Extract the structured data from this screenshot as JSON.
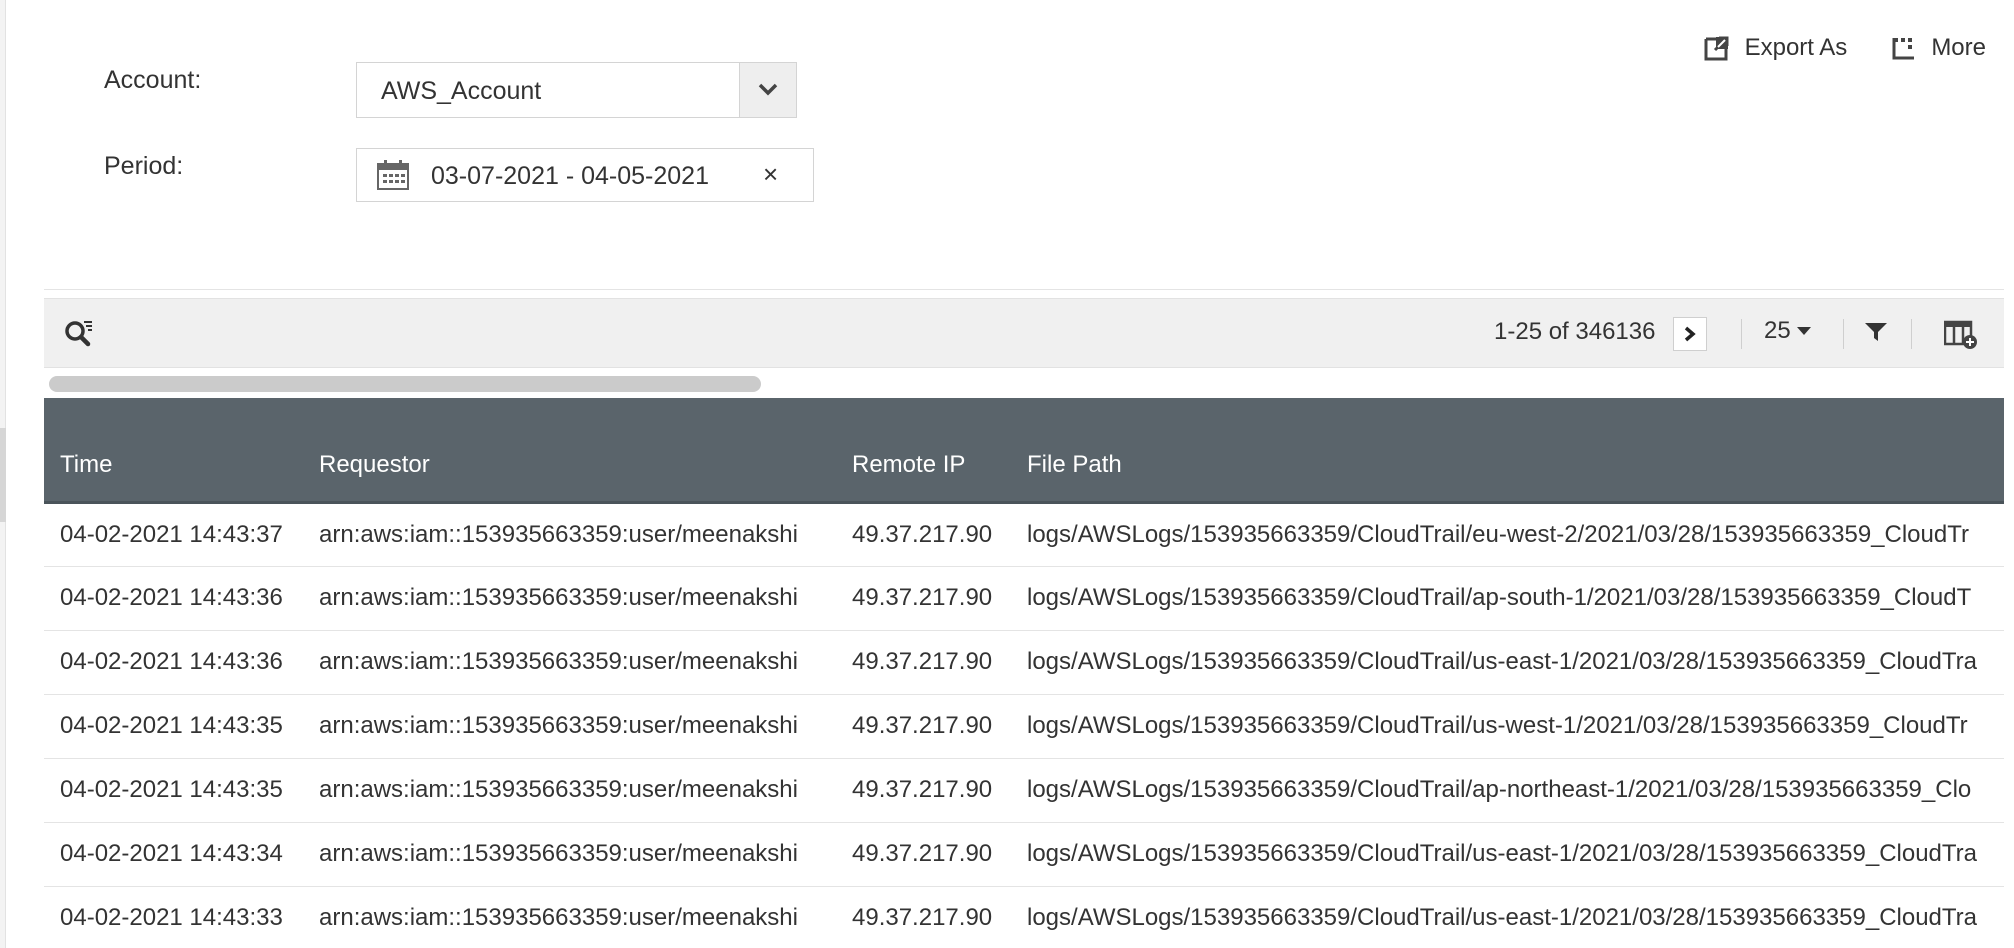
{
  "filters": {
    "account_label": "Account:",
    "account_value": "AWS_Account",
    "period_label": "Period:",
    "period_value": "03-07-2021 - 04-05-2021",
    "clear_glyph": "×"
  },
  "actions": {
    "export_label": "Export As",
    "more_label": "More"
  },
  "toolbar": {
    "pager_text": "1-25 of 346136",
    "page_size": "25"
  },
  "table": {
    "columns": [
      "Time",
      "Requestor",
      "Remote IP",
      "File Path"
    ],
    "rows": [
      [
        "04-02-2021 14:43:37",
        "arn:aws:iam::153935663359:user/meenakshi",
        "49.37.217.90",
        "logs/AWSLogs/153935663359/CloudTrail/eu-west-2/2021/03/28/153935663359_CloudTr"
      ],
      [
        "04-02-2021 14:43:36",
        "arn:aws:iam::153935663359:user/meenakshi",
        "49.37.217.90",
        "logs/AWSLogs/153935663359/CloudTrail/ap-south-1/2021/03/28/153935663359_CloudT"
      ],
      [
        "04-02-2021 14:43:36",
        "arn:aws:iam::153935663359:user/meenakshi",
        "49.37.217.90",
        "logs/AWSLogs/153935663359/CloudTrail/us-east-1/2021/03/28/153935663359_CloudTra"
      ],
      [
        "04-02-2021 14:43:35",
        "arn:aws:iam::153935663359:user/meenakshi",
        "49.37.217.90",
        "logs/AWSLogs/153935663359/CloudTrail/us-west-1/2021/03/28/153935663359_CloudTr"
      ],
      [
        "04-02-2021 14:43:35",
        "arn:aws:iam::153935663359:user/meenakshi",
        "49.37.217.90",
        "logs/AWSLogs/153935663359/CloudTrail/ap-northeast-1/2021/03/28/153935663359_Clo"
      ],
      [
        "04-02-2021 14:43:34",
        "arn:aws:iam::153935663359:user/meenakshi",
        "49.37.217.90",
        "logs/AWSLogs/153935663359/CloudTrail/us-east-1/2021/03/28/153935663359_CloudTra"
      ],
      [
        "04-02-2021 14:43:33",
        "arn:aws:iam::153935663359:user/meenakshi",
        "49.37.217.90",
        "logs/AWSLogs/153935663359/CloudTrail/us-east-1/2021/03/28/153935663359_CloudTra"
      ]
    ]
  },
  "icons": {
    "export": "export-icon",
    "more": "more-icon",
    "search": "search-filter-icon",
    "next": "chevron-right-icon",
    "filter": "funnel-icon",
    "columns": "add-column-icon",
    "calendar": "calendar-icon",
    "caret": "chevron-down-icon"
  },
  "colors": {
    "header_bg": "#5a646b",
    "toolbar_bg": "#f0f0f0"
  }
}
